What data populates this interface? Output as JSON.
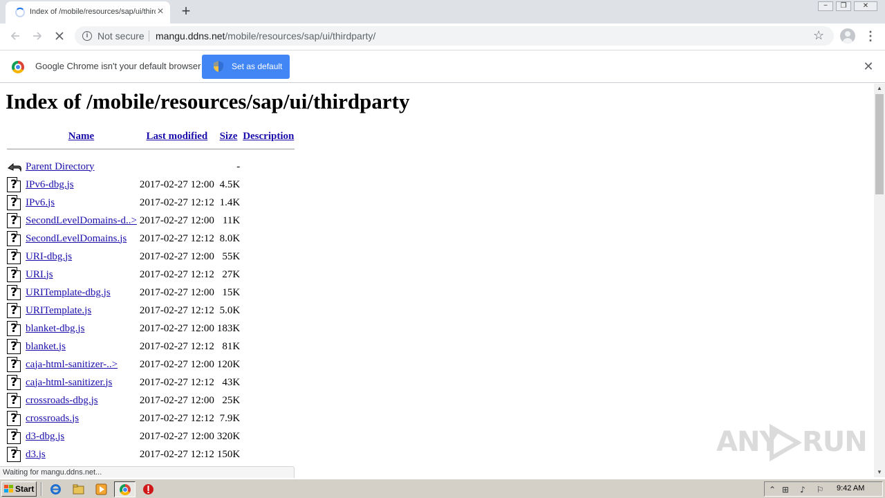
{
  "browser": {
    "tab": {
      "title": "Index of /mobile/resources/sap/ui/thirdparty"
    },
    "new_tab_glyph": "+",
    "security_label": "Not secure",
    "url_host": "mangu.ddns.net",
    "url_path": "/mobile/resources/sap/ui/thirdparty/",
    "window_controls": {
      "minimize": "−",
      "restore": "❐",
      "close": "✕"
    }
  },
  "infobar": {
    "message": "Google Chrome isn't your default browser",
    "button_label": "Set as default"
  },
  "page": {
    "heading": "Index of /mobile/resources/sap/ui/thirdparty",
    "columns": {
      "name": "Name",
      "modified": "Last modified",
      "size": "Size",
      "description": "Description"
    },
    "parent": {
      "name": "Parent Directory",
      "size": "-"
    },
    "files": [
      {
        "name": "IPv6-dbg.js",
        "modified": "2017-02-27 12:00",
        "size": "4.5K"
      },
      {
        "name": "IPv6.js",
        "modified": "2017-02-27 12:12",
        "size": "1.4K"
      },
      {
        "name": "SecondLevelDomains-d..>",
        "modified": "2017-02-27 12:00",
        "size": "11K"
      },
      {
        "name": "SecondLevelDomains.js",
        "modified": "2017-02-27 12:12",
        "size": "8.0K"
      },
      {
        "name": "URI-dbg.js",
        "modified": "2017-02-27 12:00",
        "size": "55K"
      },
      {
        "name": "URI.js",
        "modified": "2017-02-27 12:12",
        "size": "27K"
      },
      {
        "name": "URITemplate-dbg.js",
        "modified": "2017-02-27 12:00",
        "size": "15K"
      },
      {
        "name": "URITemplate.js",
        "modified": "2017-02-27 12:12",
        "size": "5.0K"
      },
      {
        "name": "blanket-dbg.js",
        "modified": "2017-02-27 12:00",
        "size": "183K"
      },
      {
        "name": "blanket.js",
        "modified": "2017-02-27 12:12",
        "size": "81K"
      },
      {
        "name": "caja-html-sanitizer-..>",
        "modified": "2017-02-27 12:00",
        "size": "120K"
      },
      {
        "name": "caja-html-sanitizer.js",
        "modified": "2017-02-27 12:12",
        "size": "43K"
      },
      {
        "name": "crossroads-dbg.js",
        "modified": "2017-02-27 12:00",
        "size": "25K"
      },
      {
        "name": "crossroads.js",
        "modified": "2017-02-27 12:12",
        "size": "7.9K"
      },
      {
        "name": "d3-dbg.js",
        "modified": "2017-02-27 12:00",
        "size": "320K"
      },
      {
        "name": "d3.js",
        "modified": "2017-02-27 12:12",
        "size": "150K"
      }
    ]
  },
  "status_text": "Waiting for mangu.ddns.net...",
  "watermark": {
    "left": "ANY",
    "right": "RUN"
  },
  "taskbar": {
    "start_label": "Start",
    "clock": "9:42 AM"
  },
  "colors": {
    "link": "#1a0dab",
    "infobar_button": "#4285f4",
    "tabstrip": "#dee1e6",
    "taskbar": "#d4d0c8"
  }
}
